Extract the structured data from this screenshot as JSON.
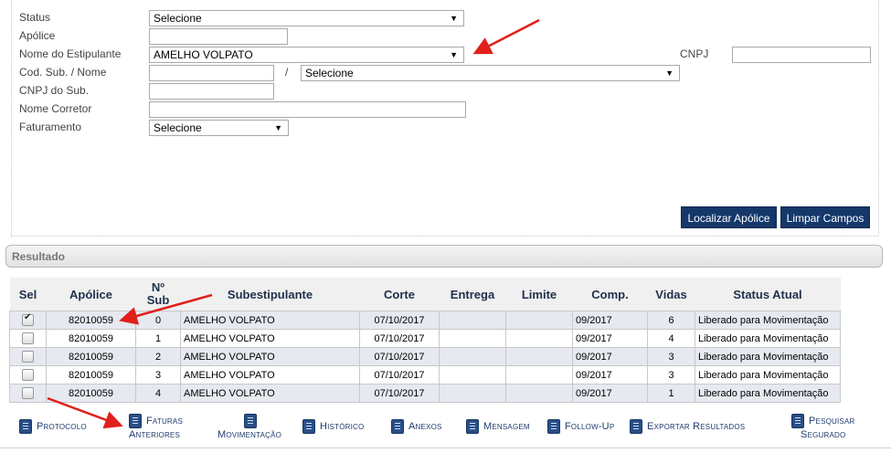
{
  "filters": {
    "status": {
      "label": "Status",
      "value": "Selecione"
    },
    "apolice": {
      "label": "Apólice",
      "value": ""
    },
    "estipulante": {
      "label": "Nome do Estipulante",
      "value": "AMELHO VOLPATO"
    },
    "cnpj": {
      "label": "CNPJ",
      "value": ""
    },
    "cod_sub": {
      "label": "Cod. Sub. / Nome",
      "value": "",
      "separator": "/",
      "nome_value": "Selecione"
    },
    "cnpj_sub": {
      "label": "CNPJ do Sub.",
      "value": ""
    },
    "corretor": {
      "label": "Nome Corretor",
      "value": ""
    },
    "faturamento": {
      "label": "Faturamento",
      "value": "Selecione"
    }
  },
  "buttons": {
    "localizar": "Localizar Apólice",
    "limpar": "Limpar Campos"
  },
  "result_title": "Resultado",
  "table": {
    "headers": [
      "Sel",
      "Apólice",
      "Nº Sub",
      "Subestipulante",
      "Corte",
      "Entrega",
      "Limite",
      "Comp.",
      "Vidas",
      "Status Atual"
    ],
    "header_sub_line1": "Nº",
    "header_sub_line2": "Sub",
    "rows": [
      {
        "checked": true,
        "apolice": "82010059",
        "sub": "0",
        "subestipulante": "AMELHO VOLPATO",
        "corte": "07/10/2017",
        "entrega": "",
        "limite": "",
        "comp": "09/2017",
        "vidas": "6",
        "status": "Liberado para Movimentação"
      },
      {
        "checked": false,
        "apolice": "82010059",
        "sub": "1",
        "subestipulante": "AMELHO VOLPATO",
        "corte": "07/10/2017",
        "entrega": "",
        "limite": "",
        "comp": "09/2017",
        "vidas": "4",
        "status": "Liberado para Movimentação"
      },
      {
        "checked": false,
        "apolice": "82010059",
        "sub": "2",
        "subestipulante": "AMELHO VOLPATO",
        "corte": "07/10/2017",
        "entrega": "",
        "limite": "",
        "comp": "09/2017",
        "vidas": "3",
        "status": "Liberado para Movimentação"
      },
      {
        "checked": false,
        "apolice": "82010059",
        "sub": "3",
        "subestipulante": "AMELHO VOLPATO",
        "corte": "07/10/2017",
        "entrega": "",
        "limite": "",
        "comp": "09/2017",
        "vidas": "3",
        "status": "Liberado para Movimentação"
      },
      {
        "checked": false,
        "apolice": "82010059",
        "sub": "4",
        "subestipulante": "AMELHO VOLPATO",
        "corte": "07/10/2017",
        "entrega": "",
        "limite": "",
        "comp": "09/2017",
        "vidas": "1",
        "status": "Liberado para Movimentação"
      }
    ]
  },
  "toolbar": {
    "protocolo": "Protocolo",
    "faturas_1": "Faturas",
    "faturas_2": "Anteriores",
    "movimentacao": "Movimentação",
    "historico": "Histórico",
    "anexos": "Anexos",
    "mensagem": "Mensagem",
    "followup": "Follow-Up",
    "exportar": "Exportar Resultados",
    "pesquisar_1": "Pesquisar",
    "pesquisar_2": "Segurado"
  },
  "colors": {
    "button_bg": "#15386b",
    "annotation_arrow": "#e0201b",
    "row_alt": "#e6e9f0"
  }
}
